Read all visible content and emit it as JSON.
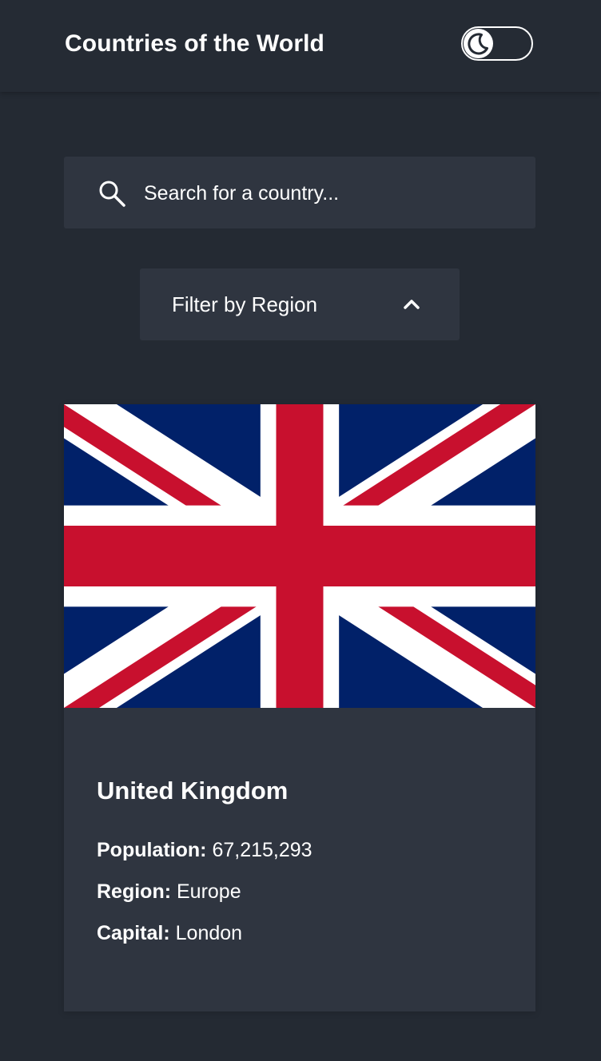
{
  "header": {
    "title": "Countries of the World",
    "theme_toggle_icon": "moon-icon",
    "theme_mode": "dark"
  },
  "search": {
    "icon": "search-icon",
    "placeholder": "Search for a country..."
  },
  "filter": {
    "label": "Filter by Region",
    "icon": "chevron-up-icon"
  },
  "countries": [
    {
      "name": "United Kingdom",
      "flag_icon": "union-jack-flag",
      "population_label": "Population:",
      "population": "67,215,293",
      "region_label": "Region:",
      "region": "Europe",
      "capital_label": "Capital:",
      "capital": "London"
    }
  ],
  "colors": {
    "background": "#242a33",
    "surface": "#2f3540",
    "text": "#ffffff",
    "flag_blue": "#012169",
    "flag_red": "#C8102E"
  }
}
